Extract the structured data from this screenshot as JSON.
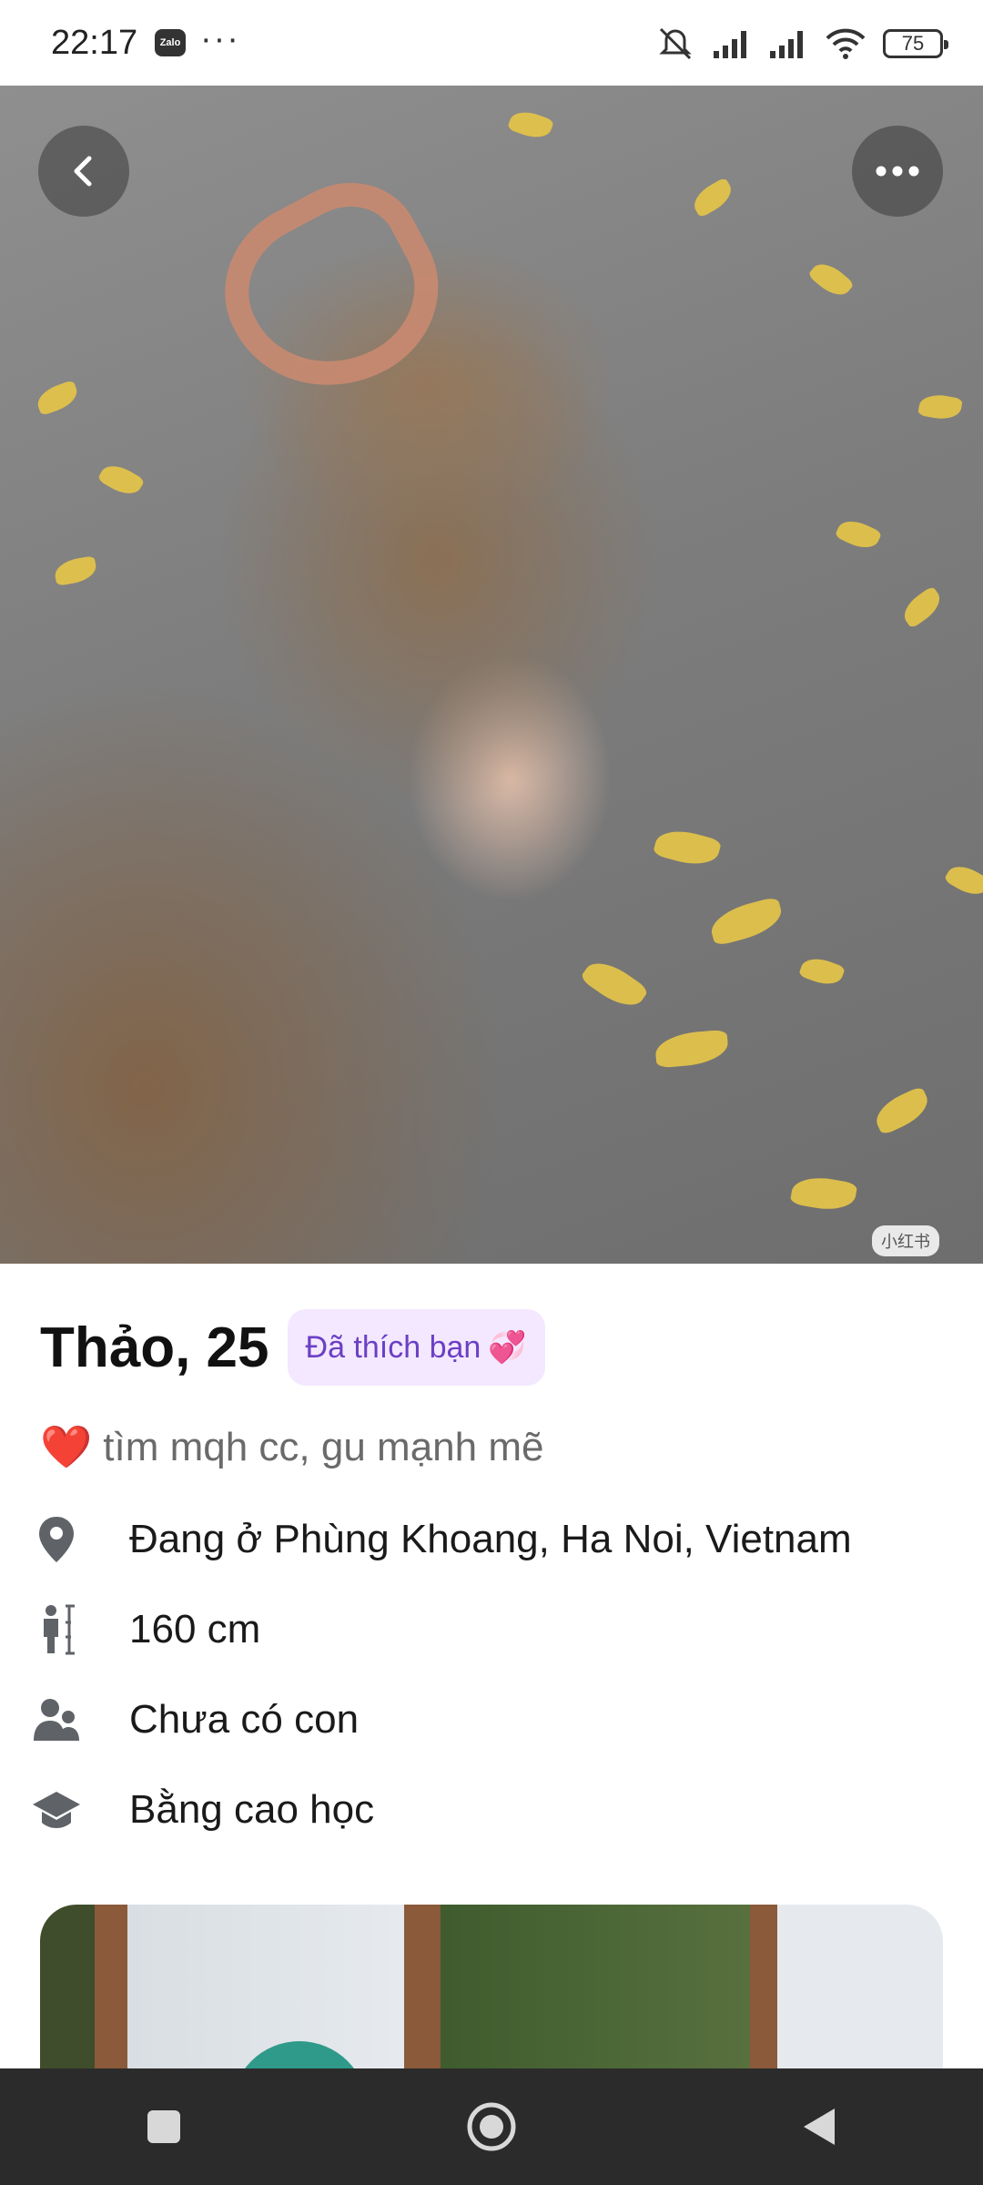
{
  "status_bar": {
    "time": "22:17",
    "app_icon": "Zalo",
    "more": "···",
    "battery": "75",
    "icons": [
      "mute-icon",
      "signal-icon",
      "signal-icon",
      "wifi-icon",
      "battery-icon"
    ]
  },
  "photo": {
    "watermark": "小红书"
  },
  "profile": {
    "name_age": "Thảo, 25",
    "liked_badge": "Đã thích bạn",
    "liked_emoji": "💞",
    "bio_emoji": "❤️",
    "bio": "tìm mqh cc, gu mạnh mẽ",
    "details": [
      {
        "icon": "location-pin-icon",
        "text": "Đang ở Phùng Khoang, Ha Noi, Vietnam"
      },
      {
        "icon": "height-icon",
        "text": "160 cm"
      },
      {
        "icon": "children-icon",
        "text": "Chưa có con"
      },
      {
        "icon": "graduation-cap-icon",
        "text": "Bằng cao học"
      }
    ]
  },
  "colors": {
    "badge_bg": "#f3e8ff",
    "badge_text": "#6b3fc4",
    "icon_gray": "#5f6368",
    "nav_bg": "#2b2b2b"
  }
}
